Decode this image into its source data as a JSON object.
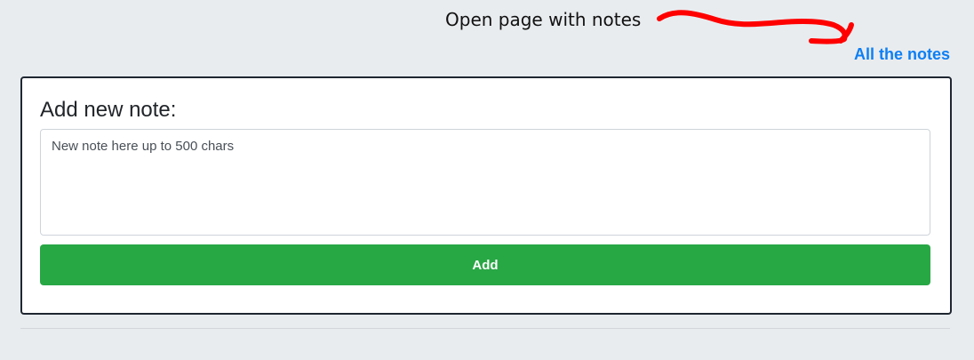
{
  "annotation": {
    "text": "Open page with notes"
  },
  "header": {
    "all_notes_link": "All the notes"
  },
  "form": {
    "title": "Add new note:",
    "textarea_placeholder": "New note here up to 500 chars",
    "textarea_value": "",
    "submit_label": "Add"
  },
  "colors": {
    "background": "#e9ecef",
    "link": "#0d7ff5",
    "button": "#28a745",
    "annotation_marks": "#ff0000"
  }
}
